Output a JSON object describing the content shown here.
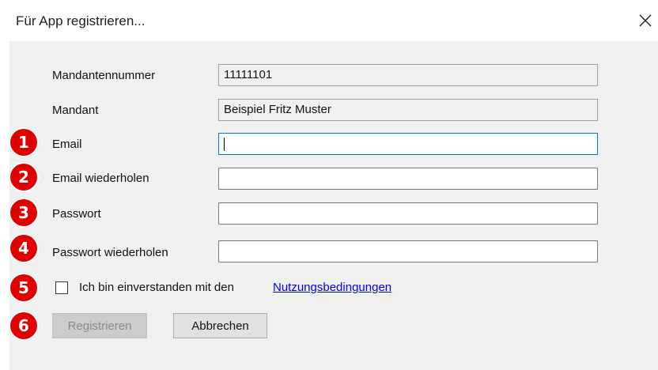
{
  "dialog": {
    "title": "Für App registrieren...",
    "close_icon": "close-icon"
  },
  "fields": [
    {
      "label": "Mandantennummer",
      "value": "11111101",
      "readonly": true
    },
    {
      "label": "Mandant",
      "value": "Beispiel Fritz Muster",
      "readonly": true
    },
    {
      "label": "Email",
      "value": "",
      "readonly": false,
      "focused": true
    },
    {
      "label": "Email wiederholen",
      "value": "",
      "readonly": false
    },
    {
      "label": "Passwort",
      "value": "",
      "readonly": false
    },
    {
      "label": "Passwort wiederholen",
      "value": "",
      "readonly": false
    }
  ],
  "agreement": {
    "checked": false,
    "text": "Ich bin einverstanden mit den",
    "link": "Nutzungsbedingungen"
  },
  "buttons": {
    "register": "Registrieren",
    "register_enabled": false,
    "cancel": "Abbrechen"
  },
  "badges": [
    "1",
    "2",
    "3",
    "4",
    "5",
    "6"
  ],
  "colors": {
    "badge": "#e00000",
    "link": "#0000ee",
    "focus_border": "#0078d7",
    "panel": "#f0f0f0"
  }
}
